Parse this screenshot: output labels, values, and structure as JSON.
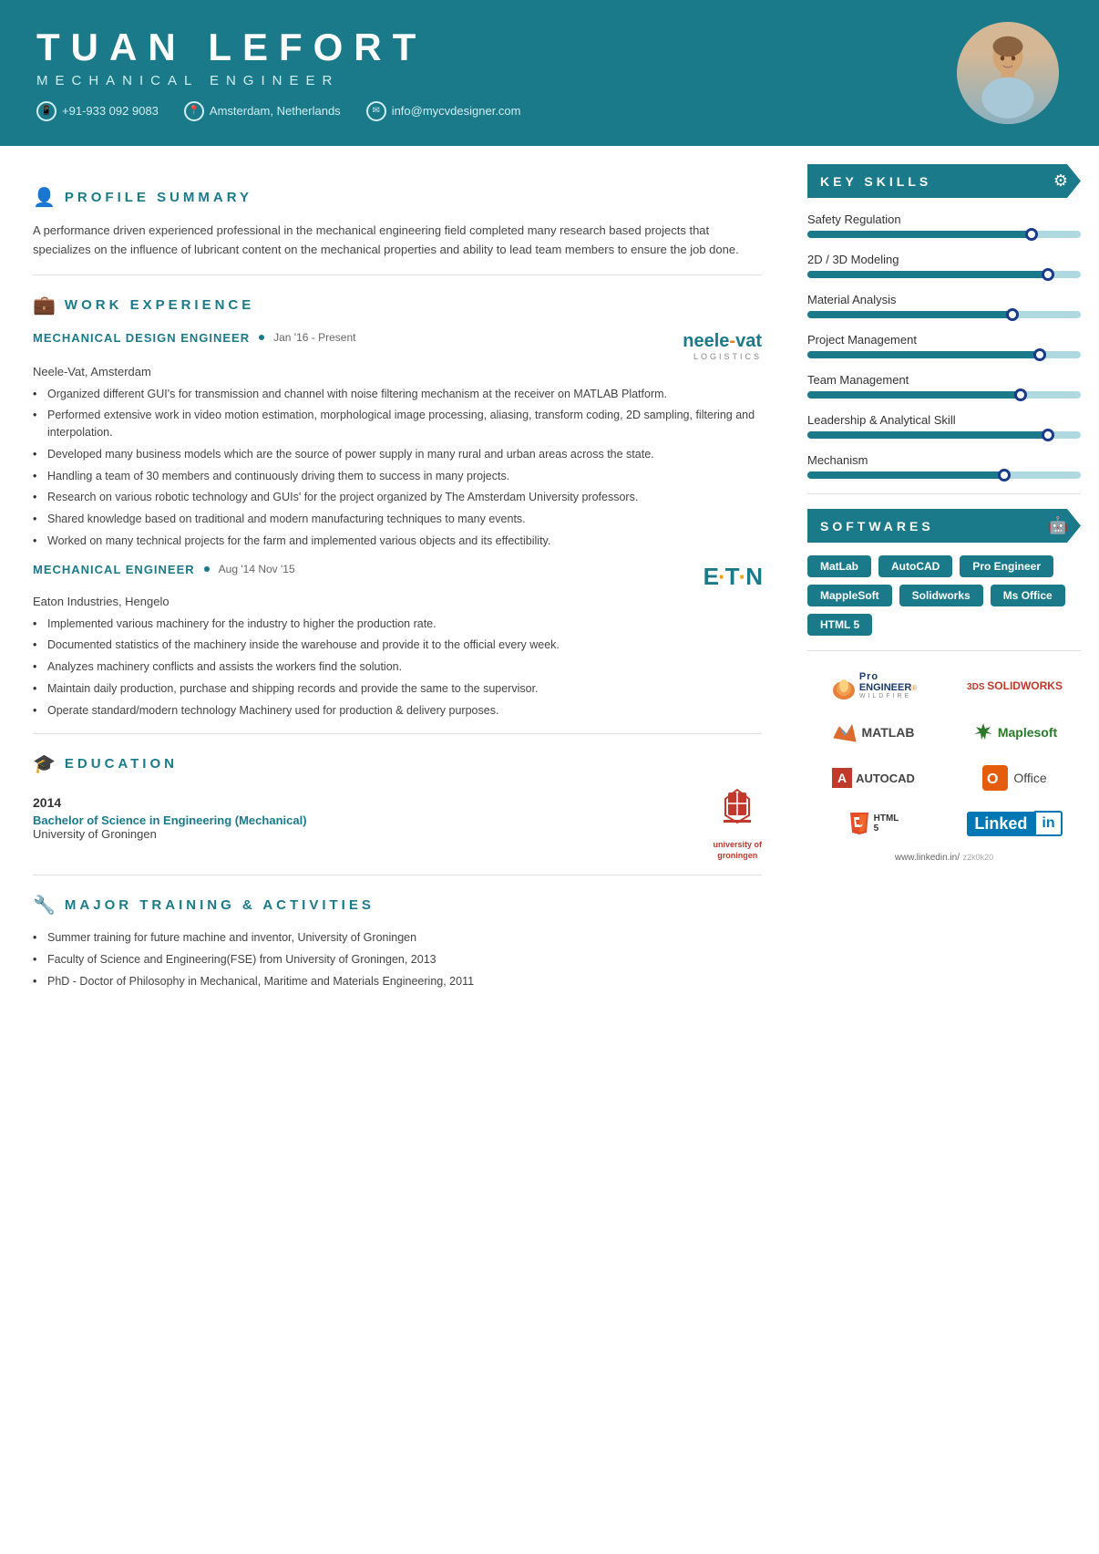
{
  "header": {
    "name": "TUAN LEFORT",
    "title": "MECHANICAL ENGINEER",
    "contact": {
      "phone": "+91-933 092 9083",
      "location": "Amsterdam, Netherlands",
      "email": "info@mycvdesigner.com"
    }
  },
  "profile": {
    "section_title": "PROFILE SUMMARY",
    "text": "A performance driven experienced professional in the mechanical engineering field completed many research based projects that specializes on the influence of lubricant content on the mechanical properties and ability to lead team members to ensure the job done."
  },
  "work_experience": {
    "section_title": "WORK EXPERIENCE",
    "jobs": [
      {
        "title": "MECHANICAL DESIGN ENGINEER",
        "date": "Jan '16 - Present",
        "company": "Neele-Vat, Amsterdam",
        "logo": "neele-vat",
        "bullets": [
          "Organized different GUI's for transmission and channel with noise filtering mechanism at the receiver on MATLAB Platform.",
          "Performed extensive work in video motion estimation, morphological image processing, aliasing, transform coding, 2D sampling, filtering and interpolation.",
          "Developed many business models which are the source of power supply in many rural and urban areas across the state.",
          "Handling a team of 30 members and continuously driving them to success in many projects.",
          "Research on various robotic technology and GUIs' for the project organized by The Amsterdam University professors.",
          "Shared knowledge based on traditional and modern manufacturing techniques to many events.",
          "Worked on many technical projects for the farm and implemented various objects and its effectibility."
        ]
      },
      {
        "title": "MECHANICAL ENGINEER",
        "date": "Aug '14 Nov '15",
        "company": "Eaton Industries, Hengelo",
        "logo": "eaton",
        "bullets": [
          "Implemented various machinery for the industry to higher the production rate.",
          "Documented statistics of the machinery inside the warehouse and provide it to the official every week.",
          "Analyzes machinery conflicts and assists the workers find the solution.",
          "Maintain daily production, purchase and shipping records and provide the same to the supervisor.",
          "Operate standard/modern technology Machinery used for production & delivery purposes."
        ]
      }
    ]
  },
  "education": {
    "section_title": "EDUCATION",
    "entries": [
      {
        "year": "2014",
        "degree": "Bachelor of Science in Engineering (Mechanical)",
        "institution": "University of Groningen"
      }
    ]
  },
  "training": {
    "section_title": "MAJOR TRAINING & ACTIVITIES",
    "bullets": [
      "Summer training for future machine and inventor, University of Groningen",
      "Faculty of Science and Engineering(FSE) from University of Groningen, 2013",
      "PhD - Doctor of Philosophy in Mechanical, Maritime and Materials Engineering, 2011"
    ]
  },
  "key_skills": {
    "section_title": "KEY SKILLS",
    "skills": [
      {
        "name": "Safety Regulation",
        "percent": 82
      },
      {
        "name": "2D / 3D Modeling",
        "percent": 88
      },
      {
        "name": "Material Analysis",
        "percent": 75
      },
      {
        "name": "Project Management",
        "percent": 85
      },
      {
        "name": "Team Management",
        "percent": 78
      },
      {
        "name": "Leadership & Analytical Skill",
        "percent": 88
      },
      {
        "name": "Mechanism",
        "percent": 72
      }
    ]
  },
  "softwares": {
    "section_title": "SOFTWARES",
    "tags": [
      "MatLab",
      "AutoCAD",
      "Pro Engineer",
      "MappleSoft",
      "Solidworks",
      "Ms Office",
      "HTML 5"
    ],
    "logos": [
      "ProENGINEER",
      "SOLIDWORKS",
      "MATLAB",
      "Maplesoft",
      "AUTOCAD",
      "Office",
      "HTML5",
      "LinkedIn"
    ]
  },
  "linkedin": {
    "url": "www.linkedin.in/",
    "watermark": "z2k0k20"
  }
}
